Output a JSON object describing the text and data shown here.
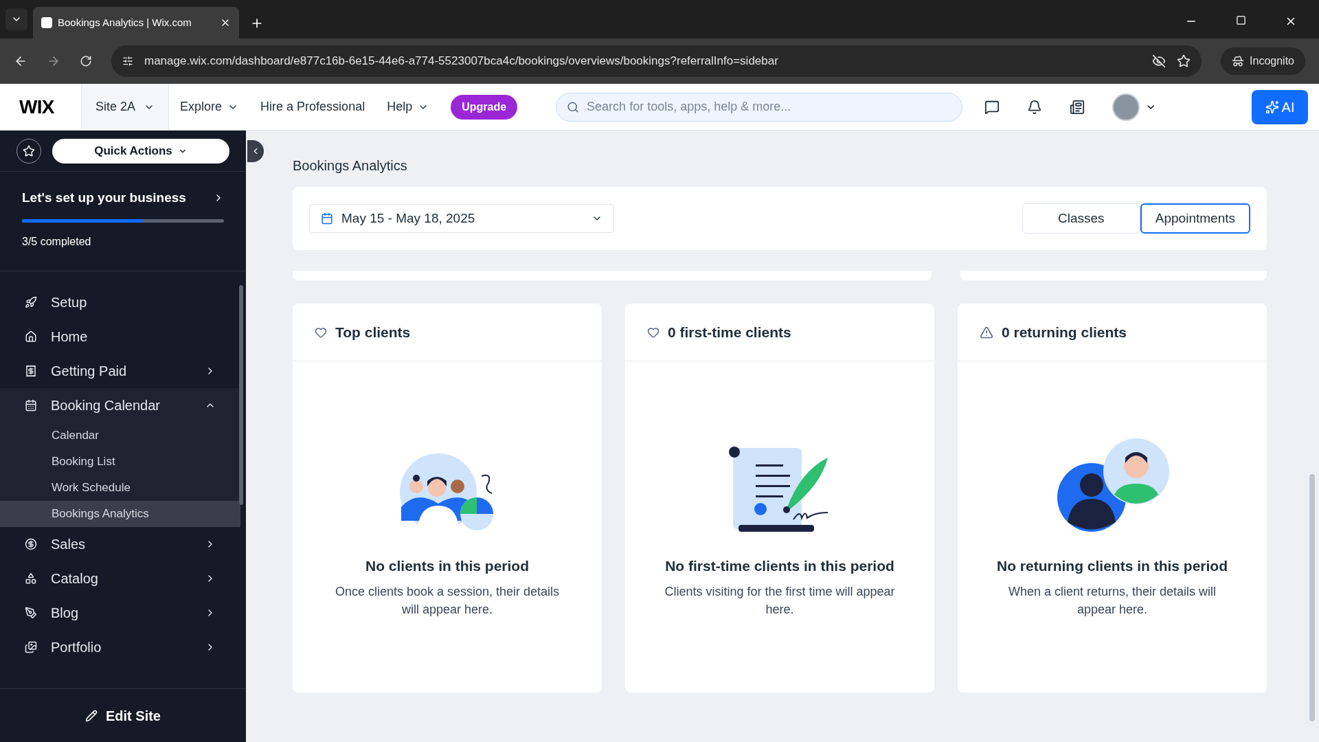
{
  "browser": {
    "tab_title": "Bookings Analytics | Wix.com",
    "url": "manage.wix.com/dashboard/e877c16b-6e15-44e6-a774-5523007bca4c/bookings/overviews/bookings?referralInfo=sidebar",
    "profile": "Incognito"
  },
  "header": {
    "logo": "WIX",
    "site": "Site 2A",
    "menu": [
      "Explore",
      "Hire a Professional",
      "Help"
    ],
    "upgrade": "Upgrade",
    "search": {
      "placeholder": "Search for tools, apps, help & more..."
    },
    "ai": "AI"
  },
  "sidebar": {
    "quick_actions": "Quick Actions",
    "setup": {
      "title": "Let's set up your business",
      "level": 0.6,
      "progress": "3/5 completed"
    },
    "items": [
      {
        "label": "Setup",
        "has_submenu": false
      },
      {
        "label": "Home",
        "has_submenu": false
      },
      {
        "label": "Getting Paid",
        "has_submenu": true,
        "expanded": false
      },
      {
        "label": "Booking Calendar",
        "has_submenu": true,
        "expanded": true,
        "children": [
          {
            "label": "Calendar",
            "selected": false
          },
          {
            "label": "Booking List",
            "selected": false
          },
          {
            "label": "Work Schedule",
            "selected": false
          },
          {
            "label": "Bookings Analytics",
            "selected": true
          }
        ]
      },
      {
        "label": "Sales",
        "has_submenu": true,
        "expanded": false
      },
      {
        "label": "Catalog",
        "has_submenu": true,
        "expanded": false
      },
      {
        "label": "Blog",
        "has_submenu": true,
        "expanded": false
      },
      {
        "label": "Portfolio",
        "has_submenu": true,
        "expanded": false
      }
    ],
    "edit_site": "Edit Site"
  },
  "page": {
    "title": "Bookings Analytics",
    "date_range": "May 15 - May 18, 2025",
    "tabs": [
      {
        "label": "Classes",
        "selected": false
      },
      {
        "label": "Appointments",
        "selected": true
      }
    ],
    "cards": [
      {
        "title": "Top clients",
        "kind": "heart",
        "empty_title": "No clients in this period",
        "empty_text": "Once clients book a session, their details will appear here."
      },
      {
        "title": "0 first-time clients",
        "kind": "heart",
        "empty_title": "No first-time clients in this period",
        "empty_text": "Clients visiting for the first time will appear here."
      },
      {
        "title": "0 returning clients",
        "kind": "warning",
        "empty_title": "No returning clients in this period",
        "empty_text": "When a client returns, their details will appear here."
      }
    ]
  }
}
